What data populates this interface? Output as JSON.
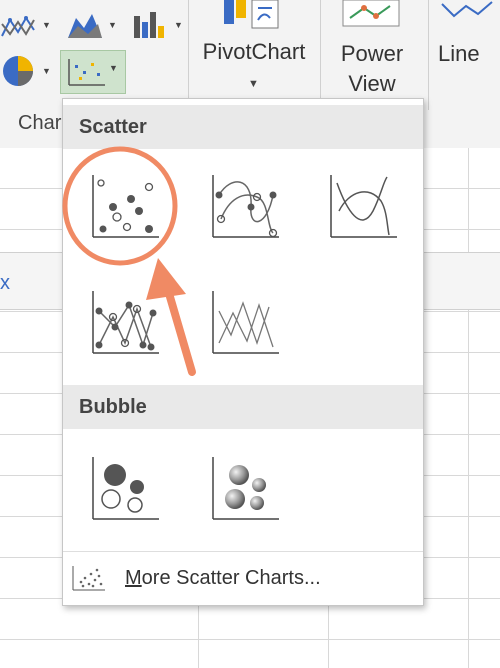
{
  "ribbon": {
    "group_label": "Char",
    "pivotchart_label": "PivotChart",
    "power_view_line1": "Power",
    "power_view_line2": "View",
    "line_label": "Line"
  },
  "dropdown": {
    "scatter_header": "Scatter",
    "bubble_header": "Bubble",
    "more_prefix": "M",
    "more_rest": "ore Scatter Charts...",
    "scatter_options": [
      {
        "icon": "scatter-markers-icon"
      },
      {
        "icon": "scatter-smooth-lines-markers-icon"
      },
      {
        "icon": "scatter-smooth-lines-icon"
      },
      {
        "icon": "scatter-straight-lines-markers-icon"
      },
      {
        "icon": "scatter-straight-lines-icon"
      }
    ],
    "bubble_options": [
      {
        "icon": "bubble-icon"
      },
      {
        "icon": "bubble-3d-icon"
      }
    ]
  },
  "grid": {
    "row_strip_glyph": "x"
  },
  "colors": {
    "annotation": "#f08a64",
    "selected_button": "#cfe3cd",
    "ribbon_bg": "#f3f3f3",
    "section_bg": "#e9e9e9"
  }
}
